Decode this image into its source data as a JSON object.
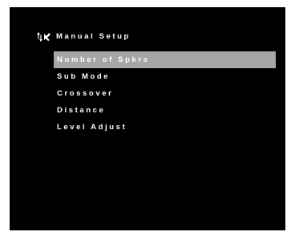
{
  "header": {
    "icon": "speaker-setup-icon",
    "title": "Manual Setup"
  },
  "menu": {
    "selected_index": 0,
    "items": [
      {
        "label": "Number of Spkrs"
      },
      {
        "label": "Sub Mode"
      },
      {
        "label": "Crossover"
      },
      {
        "label": "Distance"
      },
      {
        "label": "Level Adjust"
      }
    ]
  },
  "colors": {
    "screen_background": "#000000",
    "text": "#ffffff",
    "selection_highlight": "#a6a6a6"
  }
}
